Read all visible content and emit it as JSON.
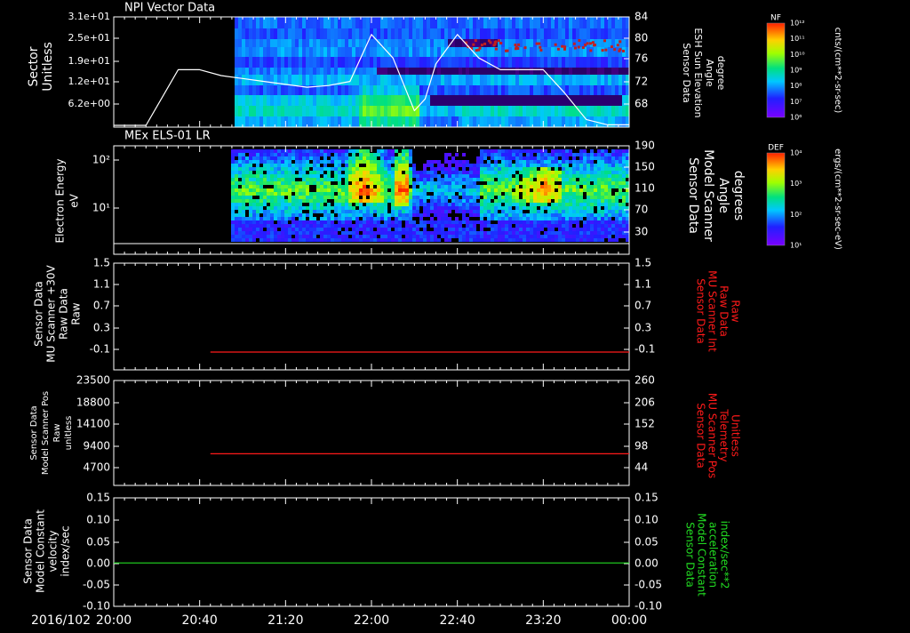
{
  "page": {
    "date_label": "2016/102",
    "time_ticks": [
      "20:00",
      "20:40",
      "21:20",
      "22:00",
      "22:40",
      "23:20",
      "00:00"
    ]
  },
  "panels": {
    "npi": {
      "title": "NPI Vector Data",
      "ylabel": [
        "Sector",
        "Unitless"
      ],
      "yticks": [
        "3.1e+01",
        "2.5e+01",
        "1.9e+01",
        "1.2e+01",
        "6.2e+00"
      ],
      "right_ticks": [
        "84",
        "80",
        "76",
        "72",
        "68"
      ],
      "right_label": [
        "Sensor Data",
        "ESH Sun Elevation",
        "Angle",
        "degree"
      ],
      "cbar_title": "NF",
      "cbar_ticks": [
        "10¹²",
        "10¹¹",
        "10¹⁰",
        "10⁹",
        "10⁸",
        "10⁷",
        "10⁶"
      ],
      "cbar_unit": "cnts/(cm**2-sr-sec)"
    },
    "els": {
      "title": "MEx ELS-01 LR",
      "ylabel": [
        "Electron Energy",
        "eV"
      ],
      "yticks": [
        "10²",
        "10¹"
      ],
      "right_ticks": [
        "190",
        "150",
        "110",
        "70",
        "30"
      ],
      "right_label": [
        "Sensor Data",
        "Model Scanner",
        "Angle",
        "degrees"
      ],
      "cbar_title": "DEF",
      "cbar_ticks": [
        "10⁴",
        "10³",
        "10²",
        "10¹"
      ],
      "cbar_unit": "ergs/(cm**2-sr-sec-eV)"
    },
    "p3": {
      "left_label": [
        "Sensor Data",
        "MU Scanner +30V",
        "Raw Data",
        "Raw"
      ],
      "yticks": [
        "1.5",
        "1.1",
        "0.7",
        "0.3",
        "-0.1"
      ],
      "right_ticks": [
        "1.5",
        "1.1",
        "0.7",
        "0.3",
        "-0.1"
      ],
      "right_label": [
        "Sensor Data",
        "MU Scanner Int",
        "Raw Data",
        "Raw"
      ]
    },
    "p4": {
      "left_label": [
        "Sensor Data",
        "Model Scanner Pos",
        "Raw",
        "unitless"
      ],
      "yticks": [
        "23500",
        "18800",
        "14100",
        "9400",
        "4700"
      ],
      "right_ticks": [
        "260",
        "206",
        "152",
        "98",
        "44"
      ],
      "right_label": [
        "Sensor Data",
        "MU Scanner Pos",
        "Telemetry",
        "Unitless"
      ]
    },
    "p5": {
      "left_label": [
        "Sensor Data",
        "Model Constant",
        "velocity",
        "index/sec"
      ],
      "yticks": [
        "0.15",
        "0.10",
        "0.05",
        "0.00",
        "-0.05",
        "-0.10"
      ],
      "right_ticks": [
        "0.15",
        "0.10",
        "0.05",
        "0.00",
        "-0.05",
        "-0.10"
      ],
      "right_label": [
        "Sensor Data",
        "Model Constant",
        "acceleration",
        "index/sec**2"
      ]
    }
  },
  "colors": {
    "axis": "#ffffff",
    "red_line": "#ff1a1a",
    "green_line": "#22dd22",
    "right_label_red": "#ff1a1a",
    "right_label_green": "#22dd22"
  },
  "chart_data": [
    {
      "type": "heatmap",
      "title": "NPI Vector Data",
      "x_range": [
        "20:00",
        "00:00"
      ],
      "y_label": "Sector Unitless",
      "overlay_line": {
        "axis": "right",
        "ylim": [
          65.2,
          84
        ],
        "x": [
          "20:00",
          "20:15",
          "20:30",
          "20:40",
          "20:50",
          "21:00",
          "21:10",
          "21:20",
          "21:30",
          "21:40",
          "21:50",
          "22:00",
          "22:10",
          "22:20",
          "22:25",
          "22:30",
          "22:40",
          "22:50",
          "23:00",
          "23:20",
          "23:30",
          "23:40",
          "23:50",
          "00:00"
        ],
        "y": [
          65.5,
          65.5,
          75.0,
          75.0,
          74.0,
          73.5,
          73.0,
          72.5,
          72.0,
          72.3,
          73.0,
          81.0,
          77.0,
          68.0,
          70.0,
          76.0,
          81.0,
          77.0,
          75.0,
          75.0,
          71.0,
          66.5,
          65.6,
          65.6
        ]
      }
    },
    {
      "type": "heatmap",
      "title": "MEx ELS-01 LR",
      "x_range": [
        "20:00",
        "00:00"
      ],
      "y_label": "Electron Energy eV",
      "note": "data begins ~20:53"
    },
    {
      "type": "line",
      "x": [
        "20:45",
        "00:00"
      ],
      "y": [
        0.0,
        0.0
      ],
      "ylim": [
        -0.3,
        1.5
      ]
    },
    {
      "type": "line",
      "x": [
        "20:45",
        "00:00"
      ],
      "y": [
        7100,
        7100
      ],
      "ylim": [
        0,
        23500
      ]
    },
    {
      "type": "line",
      "x": [
        "20:00",
        "00:00"
      ],
      "y": [
        0.0,
        0.0
      ],
      "ylim": [
        -0.1,
        0.15
      ]
    }
  ]
}
